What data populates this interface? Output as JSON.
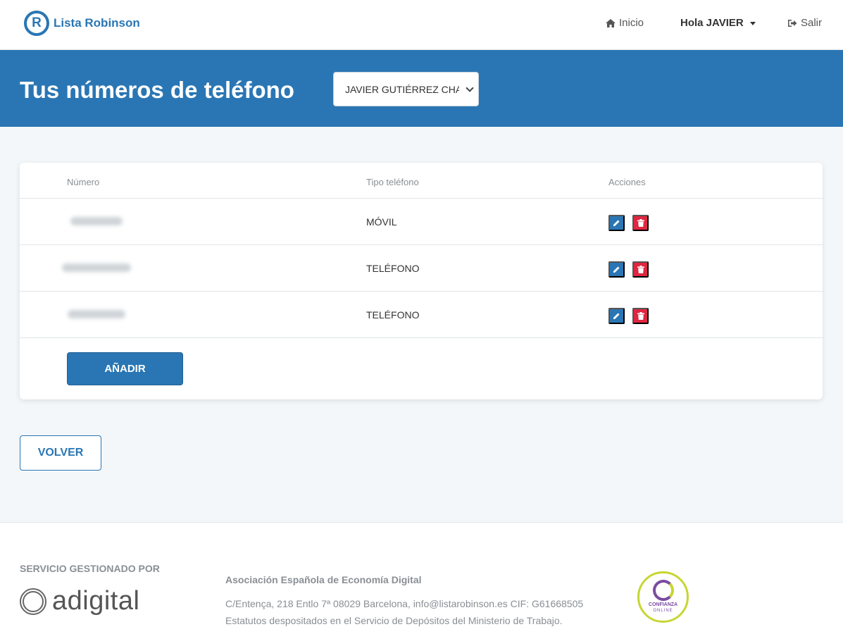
{
  "app": {
    "logo_letter": "R",
    "logo_text": "Lista Robinson"
  },
  "nav": {
    "home_label": "Inicio",
    "user_label": "Hola JAVIER",
    "logout_label": "Salir"
  },
  "banner": {
    "title": "Tus números de teléfono",
    "person_select_value": "JAVIER GUTIÉRREZ CHA"
  },
  "table": {
    "headers": [
      "Número",
      "Tipo teléfono",
      "Acciones"
    ],
    "rows": [
      {
        "number": "",
        "type": "MÓVIL"
      },
      {
        "number": "",
        "type": "TELÉFONO"
      },
      {
        "number": "",
        "type": "TELÉFONO"
      }
    ],
    "add_label": "AÑADIR"
  },
  "back_label": "VOLVER",
  "footer": {
    "managed_by": "SERVICIO GESTIONADO POR",
    "partner_logo_text": "adigital",
    "org_name": "Asociación Española de Economía Digital",
    "address": "C/Entença, 218 Entlo 7ª 08029 Barcelona, info@listarobinson.es CIF: G61668505",
    "statutes": "Estatutos despositados en el Servicio de Depósitos del Ministerio de Trabajo.",
    "badge_line1": "CONFIANZA",
    "badge_line2": "ONLINE"
  },
  "colors": {
    "primary": "#2a76b4",
    "danger": "#e02640",
    "badge_lime": "#c7d631",
    "badge_purple": "#7a4ba0"
  },
  "icons": {
    "home": "home-icon",
    "logout": "logout-icon",
    "edit": "pencil-icon",
    "delete": "trash-icon"
  }
}
